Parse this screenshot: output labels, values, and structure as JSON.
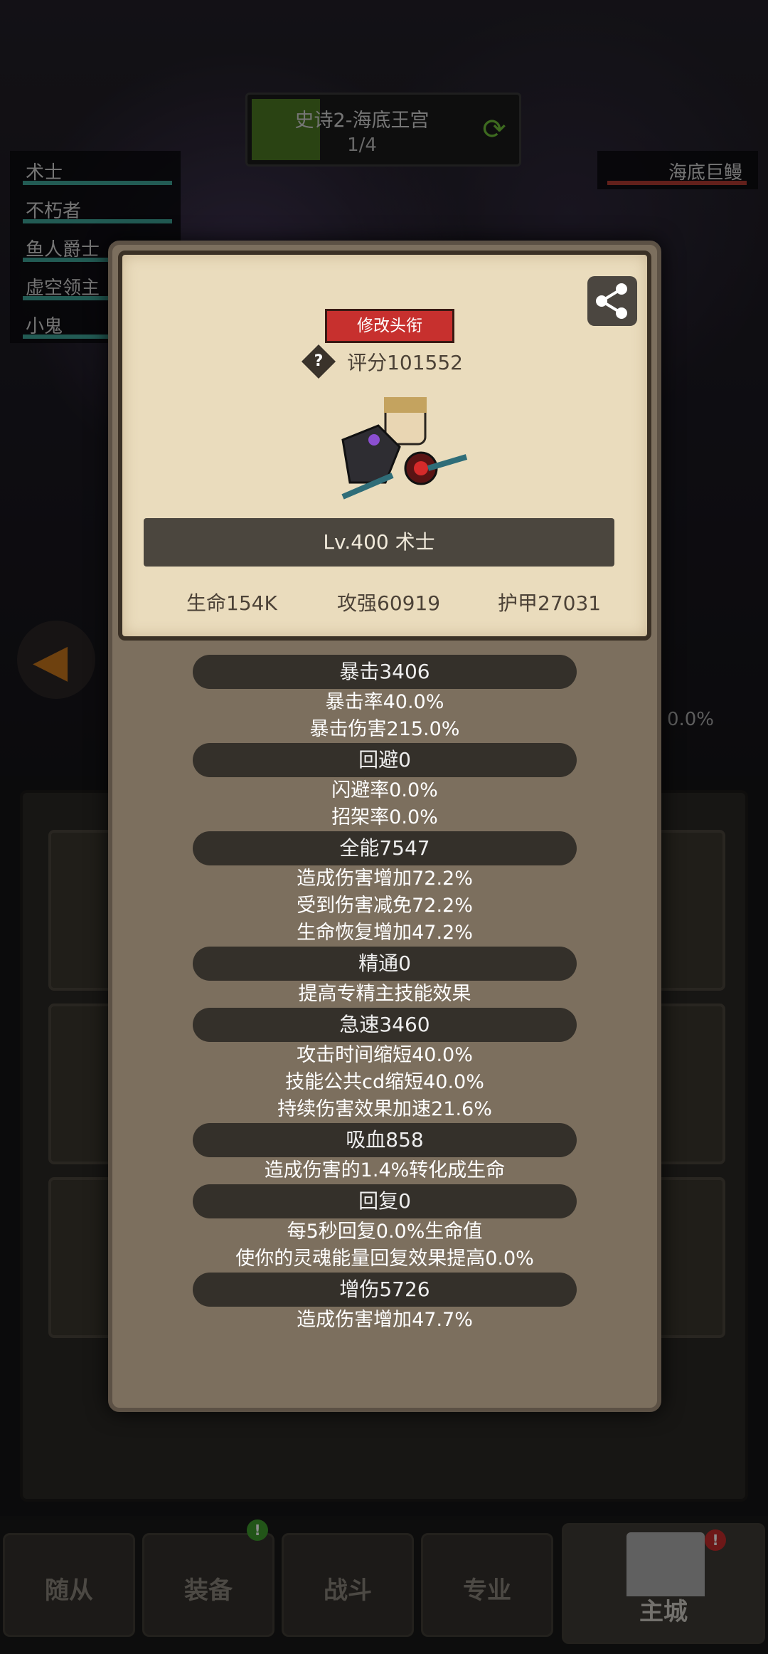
{
  "stage": {
    "title": "史诗2-海底王宫",
    "count": "1/4",
    "progress": 0.25
  },
  "party": [
    {
      "name": "术士"
    },
    {
      "name": "不朽者"
    },
    {
      "name": "鱼人爵士"
    },
    {
      "name": "虚空领主"
    },
    {
      "name": "小鬼"
    }
  ],
  "enemy": {
    "name": "海底巨鳗"
  },
  "background": {
    "pct": "0.0%"
  },
  "modal": {
    "title_button": "修改头衔",
    "help_mark": "?",
    "score": "评分101552",
    "level_name": "Lv.400 术士",
    "stats": {
      "hp": "生命154K",
      "attack": "攻强60919",
      "armor": "护甲27031"
    },
    "sections": [
      {
        "head": "暴击3406",
        "lines": [
          "暴击率40.0%",
          "暴击伤害215.0%"
        ]
      },
      {
        "head": "回避0",
        "lines": [
          "闪避率0.0%",
          "招架率0.0%"
        ]
      },
      {
        "head": "全能7547",
        "lines": [
          "造成伤害增加72.2%",
          "受到伤害减免72.2%",
          "生命恢复增加47.2%"
        ]
      },
      {
        "head": "精通0",
        "lines": [
          "提高专精主技能效果"
        ]
      },
      {
        "head": "急速3460",
        "lines": [
          "攻击时间缩短40.0%",
          "技能公共cd缩短40.0%",
          "持续伤害效果加速21.6%"
        ]
      },
      {
        "head": "吸血858",
        "lines": [
          "造成伤害的1.4%转化成生命"
        ]
      },
      {
        "head": "回复0",
        "lines": [
          "每5秒回复0.0%生命值",
          "使你的灵魂能量回复效果提高0.0%"
        ]
      },
      {
        "head": "增伤5726",
        "lines": [
          "造成伤害增加47.7%"
        ]
      }
    ]
  },
  "nav": {
    "followers": "随从",
    "equipment": "装备",
    "battle": "战斗",
    "profession": "专业",
    "main_city": "主城",
    "badge": "!"
  },
  "colors": {
    "stage_progress": "#4d7a24",
    "party_hp": "#3fa69a",
    "enemy_hp": "#b33b32",
    "title_button": "#c7302e",
    "card_bg": "#eadcbd"
  }
}
